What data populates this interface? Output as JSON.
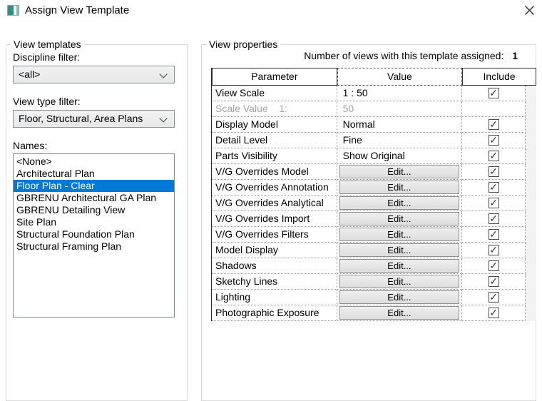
{
  "window": {
    "title": "Assign View Template"
  },
  "left_panel": {
    "group_label": "View templates",
    "discipline_filter": {
      "label": "Discipline filter:",
      "value": "<all>"
    },
    "view_type_filter": {
      "label": "View type filter:",
      "value": "Floor, Structural, Area Plans"
    },
    "names": {
      "label": "Names:",
      "items": [
        "<None>",
        "Architectural Plan",
        "Floor Plan - Clear",
        "GBRENU Architectural GA Plan",
        "GBRENU Detailing View",
        "Site Plan",
        "Structural Foundation Plan",
        "Structural Framing Plan"
      ],
      "selected_index": 2
    }
  },
  "right_panel": {
    "group_label": "View properties",
    "assigned_count_label": "Number of views with this template assigned:",
    "assigned_count": "1",
    "table": {
      "columns": [
        "Parameter",
        "Value",
        "Include"
      ],
      "rows": [
        {
          "parameter": "View Scale",
          "value": "1 : 50",
          "value_type": "text",
          "include": true,
          "disabled": false
        },
        {
          "parameter": "Scale Value    1:",
          "value": "50",
          "value_type": "text",
          "include": false,
          "disabled": true
        },
        {
          "parameter": "Display Model",
          "value": "Normal",
          "value_type": "text",
          "include": true,
          "disabled": false
        },
        {
          "parameter": "Detail Level",
          "value": "Fine",
          "value_type": "text",
          "include": true,
          "disabled": false
        },
        {
          "parameter": "Parts Visibility",
          "value": "Show Original",
          "value_type": "text",
          "include": true,
          "disabled": false
        },
        {
          "parameter": "V/G Overrides Model",
          "value": "Edit...",
          "value_type": "button",
          "include": true,
          "disabled": false
        },
        {
          "parameter": "V/G Overrides Annotation",
          "value": "Edit...",
          "value_type": "button",
          "include": true,
          "disabled": false
        },
        {
          "parameter": "V/G Overrides Analytical",
          "value": "Edit...",
          "value_type": "button",
          "include": true,
          "disabled": false
        },
        {
          "parameter": "V/G Overrides Import",
          "value": "Edit...",
          "value_type": "button",
          "include": true,
          "disabled": false
        },
        {
          "parameter": "V/G Overrides Filters",
          "value": "Edit...",
          "value_type": "button",
          "include": true,
          "disabled": false
        },
        {
          "parameter": "Model Display",
          "value": "Edit...",
          "value_type": "button",
          "include": true,
          "disabled": false
        },
        {
          "parameter": "Shadows",
          "value": "Edit...",
          "value_type": "button",
          "include": true,
          "disabled": false
        },
        {
          "parameter": "Sketchy Lines",
          "value": "Edit...",
          "value_type": "button",
          "include": true,
          "disabled": false
        },
        {
          "parameter": "Lighting",
          "value": "Edit...",
          "value_type": "button",
          "include": true,
          "disabled": false
        },
        {
          "parameter": "Photographic Exposure",
          "value": "Edit...",
          "value_type": "button",
          "include": true,
          "disabled": false
        }
      ]
    }
  },
  "colors": {
    "selection": "#0078d7",
    "accent_teal": "#2e8f85",
    "disabled_text": "#a3a3a3"
  }
}
